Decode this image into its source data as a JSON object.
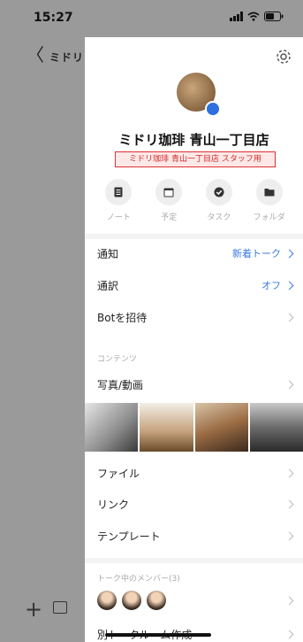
{
  "status": {
    "time": "15:27"
  },
  "background": {
    "back_glyph": "〈",
    "title": "ミドリ"
  },
  "profile": {
    "name": "ミドリ珈琲 青山一丁目店",
    "subname": "ミドリ珈琲 青山一丁目店 スタッフ用"
  },
  "actions": [
    {
      "label": "ノート",
      "icon": "note-icon"
    },
    {
      "label": "予定",
      "icon": "calendar-icon"
    },
    {
      "label": "タスク",
      "icon": "check-icon"
    },
    {
      "label": "フォルダ",
      "icon": "folder-icon"
    }
  ],
  "settings": {
    "notifications": {
      "label": "通知",
      "value": "新着トーク"
    },
    "translation": {
      "label": "通訳",
      "value": "オフ"
    },
    "invite_bot": {
      "label": "Botを招待"
    }
  },
  "contents": {
    "heading": "コンテンツ",
    "photos_label": "写真/動画",
    "files_label": "ファイル",
    "links_label": "リンク",
    "templates_label": "テンプレート"
  },
  "members": {
    "heading": "トーク中のメンバー(3)"
  },
  "more": {
    "new_room_label": "別トークルーム作成"
  },
  "colors": {
    "accent": "#3b7be0",
    "highlight_border": "#e03030"
  }
}
